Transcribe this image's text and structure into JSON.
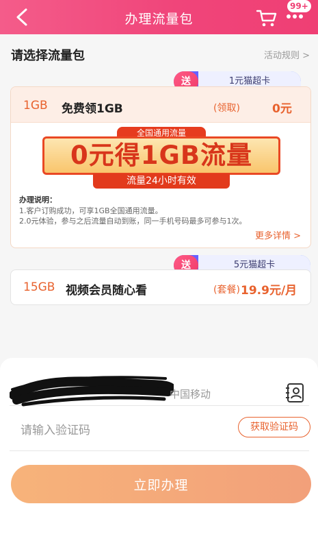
{
  "header": {
    "title": "办理流量包",
    "badge": "99+",
    "accent": "#ef3f74"
  },
  "section": {
    "title": "请选择流量包",
    "rules_link": "活动规则 >"
  },
  "packages": [
    {
      "gift_prefix": "送",
      "gift_label": "1元猫超卡",
      "size": "1GB",
      "name": "免费领1GB",
      "action": "(领取)",
      "price": "0元",
      "banner": {
        "top": "全国通用流量",
        "main": "0元得1GB流量",
        "bottom": "流量24小时有效"
      },
      "desc_title": "办理说明：",
      "desc_lines": [
        "1.客户订购成功，可享1GB全国通用流量。",
        "2.0元体验，参与之后流量自动到账，同一手机号码最多可参与1次。"
      ],
      "more": "更多详情 >"
    },
    {
      "gift_prefix": "送",
      "gift_label": "5元猫超卡",
      "size": "15GB",
      "name": "视频会员随心看",
      "action": "(套餐)",
      "price": "19.9元/月"
    }
  ],
  "form": {
    "carrier": "中国移动",
    "code_placeholder": "请输入验证码",
    "get_code": "获取验证码",
    "submit": "立即办理"
  }
}
